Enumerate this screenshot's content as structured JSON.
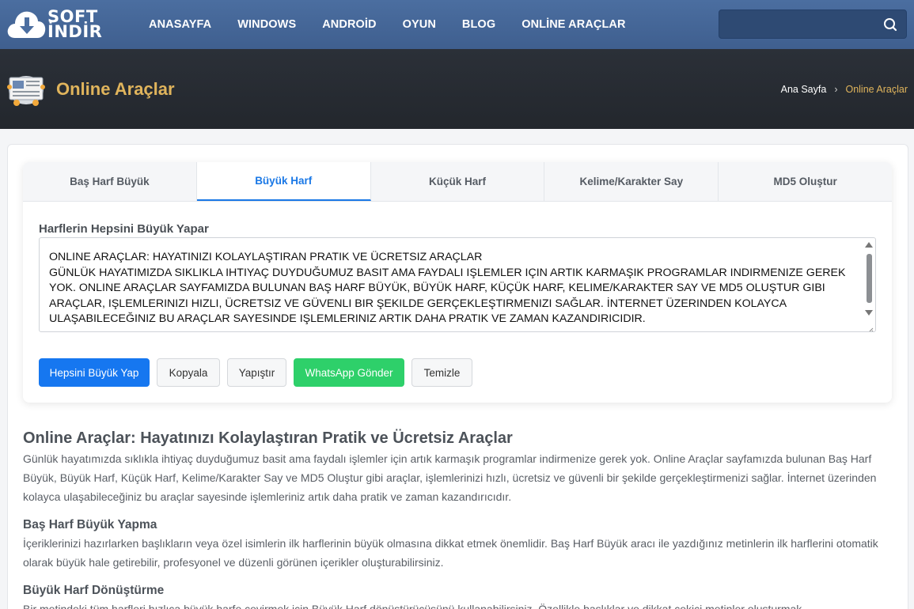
{
  "nav": {
    "logo_line1": "SOFT",
    "logo_line2": "İNDİR",
    "items": [
      "ANASAYFA",
      "WINDOWS",
      "ANDROİD",
      "OYUN",
      "BLOG",
      "ONLİNE ARAÇLAR"
    ],
    "search_placeholder": ""
  },
  "header": {
    "title": "Online Araçlar",
    "breadcrumb_home": "Ana Sayfa",
    "breadcrumb_sep": "›",
    "breadcrumb_current": "Online Araçlar"
  },
  "tool": {
    "tabs": [
      "Baş Harf Büyük",
      "Büyük Harf",
      "Küçük Harf",
      "Kelime/Karakter Say",
      "MD5 Oluştur"
    ],
    "active_tab": "Büyük Harf",
    "label": "Harflerin Hepsini Büyük Yapar",
    "textarea_value": "ONLINE ARAÇLAR: HAYATINIZI KOLAYLAŞTIRAN PRATIK VE ÜCRETSIZ ARAÇLAR\nGÜNLÜK HAYATIMIZDA SIKLIKLA IHTIYAÇ DUYDUĞUMUZ BASIT AMA FAYDALI IŞLEMLER IÇIN ARTIK KARMAŞIK PROGRAMLAR INDIRMENIZE GEREK YOK. ONLINE ARAÇLAR SAYFAMIZDA BULUNAN BAŞ HARF BÜYÜK, BÜYÜK HARF, KÜÇÜK HARF, KELIME/KARAKTER SAY VE MD5 OLUŞTUR GIBI ARAÇLAR, IŞLEMLERINIZI HIZLI, ÜCRETSIZ VE GÜVENLI BIR ŞEKILDE GERÇEKLEŞTIRMENIZI SAĞLAR. İNTERNET ÜZERINDEN KOLAYCA ULAŞABILECEĞINIZ BU ARAÇLAR SAYESINDE IŞLEMLERINIZ ARTIK DAHA PRATIK VE ZAMAN KAZANDIRICIDIR.",
    "buttons": {
      "uppercase": "Hepsini Büyük Yap",
      "copy": "Kopyala",
      "paste": "Yapıştır",
      "whatsapp": "WhatsApp Gönder",
      "clear": "Temizle"
    },
    "colors": {
      "accent": "#1677f0",
      "whatsapp": "#2ed06a"
    }
  },
  "article": {
    "h1": "Online Araçlar: Hayatınızı Kolaylaştıran Pratik ve Ücretsiz Araçlar",
    "p1": "Günlük hayatımızda sıklıkla ihtiyaç duyduğumuz basit ama faydalı işlemler için artık karmaşık programlar indirmenize gerek yok. Online Araçlar sayfamızda bulunan Baş Harf Büyük, Büyük Harf, Küçük Harf, Kelime/Karakter Say ve MD5 Oluştur gibi araçlar, işlemlerinizi hızlı, ücretsiz ve güvenli bir şekilde gerçekleştirmenizi sağlar. İnternet üzerinden kolayca ulaşabileceğiniz bu araçlar sayesinde işlemleriniz artık daha pratik ve zaman kazandırıcıdır.",
    "h2a": "Baş Harf Büyük Yapma",
    "p2": "İçeriklerinizi hazırlarken başlıkların veya özel isimlerin ilk harflerinin büyük olmasına dikkat etmek önemlidir. Baş Harf Büyük aracı ile yazdığınız metinlerin ilk harflerini otomatik olarak büyük hale getirebilir, profesyonel ve düzenli görünen içerikler oluşturabilirsiniz.",
    "h2b": "Büyük Harf Dönüştürme",
    "p3": "Bir metindeki tüm harfleri hızlıca büyük harfe çevirmek için Büyük Harf dönüştürücüsünü kullanabilirsiniz. Özellikle başlıklar ve dikkat çekici metinler oluşturmak"
  }
}
